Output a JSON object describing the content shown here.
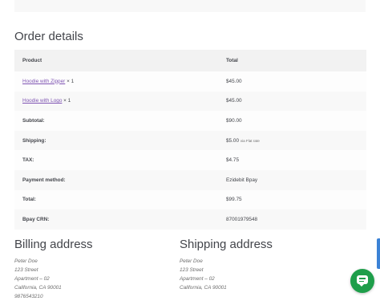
{
  "top_box": {
    "cut_text": "• ••••• ••"
  },
  "order_details": {
    "title": "Order details",
    "columns": [
      "Product",
      "Total"
    ],
    "items": [
      {
        "name": "Hoodie with Zipper",
        "qty": "× 1",
        "total": "$45.00"
      },
      {
        "name": "Hoodie with Logo",
        "qty": "× 1",
        "total": "$45.00"
      }
    ],
    "summary": [
      {
        "label": "Subtotal:",
        "value": "$90.00",
        "note": ""
      },
      {
        "label": "Shipping:",
        "value": "$5.00",
        "note": "via Flat rate"
      },
      {
        "label": "TAX:",
        "value": "$4.75",
        "note": ""
      },
      {
        "label": "Payment method:",
        "value": "Ezidebit Bpay",
        "note": ""
      },
      {
        "label": "Total:",
        "value": "$99.75",
        "note": ""
      },
      {
        "label": "Bpay CRN:",
        "value": "87001979548",
        "note": ""
      }
    ]
  },
  "billing": {
    "title": "Billing address",
    "lines": [
      "Peter Doe",
      "123 Street",
      "Apartment – 02",
      "California, CA 90001",
      "9876543210"
    ]
  },
  "shipping": {
    "title": "Shipping address",
    "lines": [
      "Peter Doe",
      "123 Street",
      "Apartment – 02",
      "California, CA 90001"
    ]
  },
  "colors": {
    "link": "#7f54b3",
    "chat": "#1e9e4a",
    "side_tab": "#3b82d6"
  },
  "icons": {
    "chat_button": "chat-bubble-icon"
  }
}
